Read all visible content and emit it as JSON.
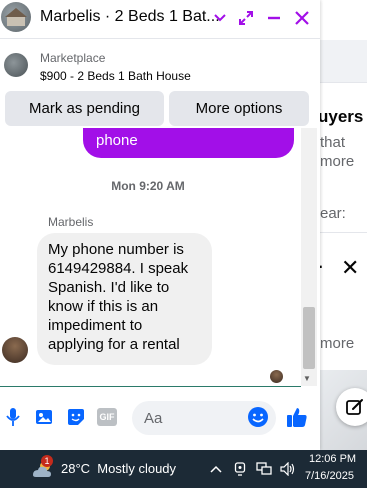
{
  "chat": {
    "title": "Marbelis · 2 Beds 1 Bat...",
    "listing": {
      "source": "Marketplace",
      "title": "$900 - 2 Beds 1 Bath House"
    },
    "actions": {
      "pending_label": "Mark as pending",
      "more_label": "More options"
    },
    "thread": {
      "outgoing_partial": "phone",
      "timestamp": "Mon 9:20 AM",
      "sender": "Marbelis",
      "message": "My phone number is 6149429884. I speak Spanish. I'd like to know if this is an impediment to applying for a rental"
    },
    "composer": {
      "placeholder": "Aa",
      "gif_label": "GIF"
    }
  },
  "background": {
    "heading_fragment": "uyers",
    "line1": "that",
    "line2": "more",
    "line3": "ear:",
    "more_link": "more"
  },
  "taskbar": {
    "temperature": "28°C",
    "weather": "Mostly cloudy",
    "weather_badge": "1",
    "time": "12:06 PM",
    "date": "7/16/2025"
  },
  "colors": {
    "accent": "#a20fe8",
    "icon_blue": "#0866ff",
    "taskbar": "#1c2a36"
  }
}
